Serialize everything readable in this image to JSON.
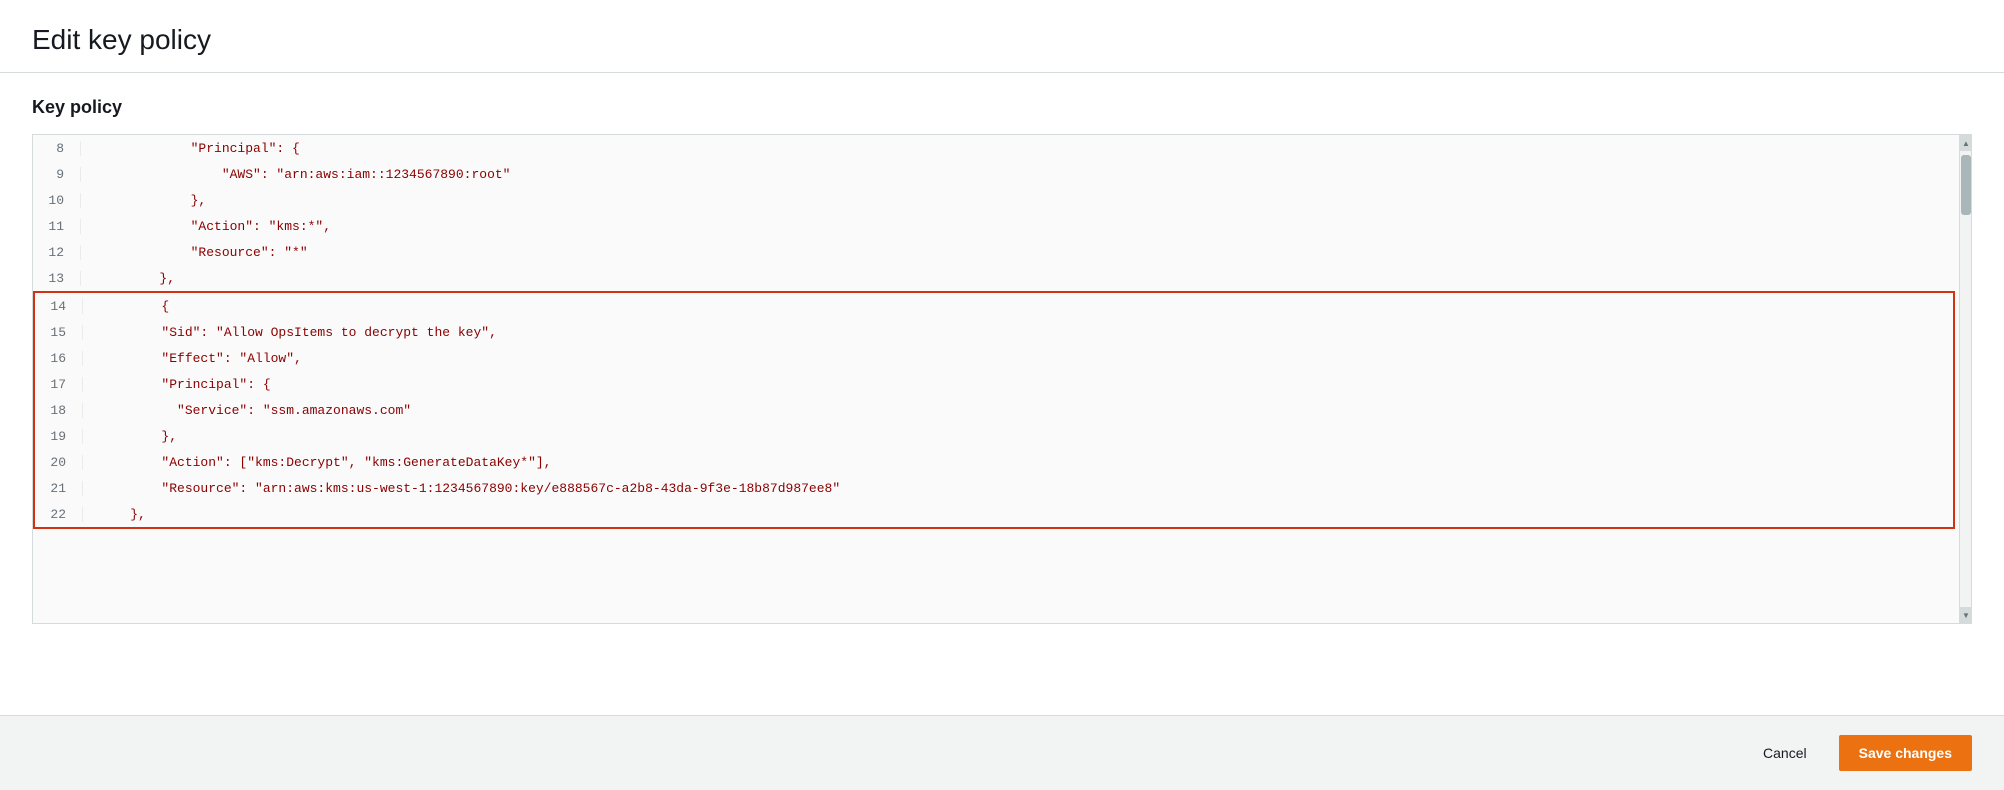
{
  "page": {
    "title": "Edit key policy",
    "background_color": "#f2f3f3"
  },
  "header": {
    "title": "Edit key policy"
  },
  "section": {
    "title": "Key policy"
  },
  "editor": {
    "lines": [
      {
        "number": "8",
        "indent": "            ",
        "content": "\"Principal\": {"
      },
      {
        "number": "9",
        "indent": "                ",
        "content": "\"AWS\": \"arn:aws:iam::1234567890:root\""
      },
      {
        "number": "10",
        "indent": "            ",
        "content": "},"
      },
      {
        "number": "11",
        "indent": "            ",
        "content": "\"Action\": \"kms:*\","
      },
      {
        "number": "12",
        "indent": "            ",
        "content": "\"Resource\": \"*\""
      },
      {
        "number": "13",
        "indent": "        ",
        "content": "},"
      },
      {
        "number": "14",
        "indent": "        ",
        "content": "{",
        "highlight_start": true
      },
      {
        "number": "15",
        "indent": "        ",
        "content": "\"Sid\": \"Allow OpsItems to decrypt the key\","
      },
      {
        "number": "16",
        "indent": "        ",
        "content": "\"Effect\": \"Allow\","
      },
      {
        "number": "17",
        "indent": "        ",
        "content": "\"Principal\": {"
      },
      {
        "number": "18",
        "indent": "          ",
        "content": "\"Service\": \"ssm.amazonaws.com\""
      },
      {
        "number": "19",
        "indent": "        ",
        "content": "},"
      },
      {
        "number": "20",
        "indent": "        ",
        "content": "\"Action\": [\"kms:Decrypt\", \"kms:GenerateDataKey*\"],"
      },
      {
        "number": "21",
        "indent": "        ",
        "content": "\"Resource\": \"arn:aws:kms:us-west-1:1234567890:key/e888567c-a2b8-43da-9f3e-18b87d987ee8\""
      },
      {
        "number": "22",
        "indent": "    ",
        "content": "},",
        "highlight_end": true
      }
    ]
  },
  "footer": {
    "cancel_label": "Cancel",
    "save_label": "Save changes"
  }
}
